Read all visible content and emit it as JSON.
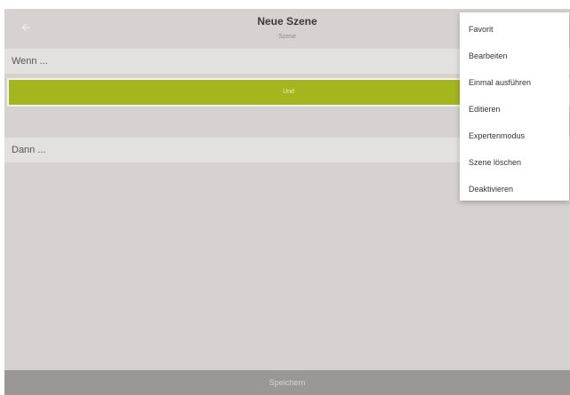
{
  "header": {
    "title": "Neue Szene",
    "subtitle": "Szene",
    "back_icon": "arrow-left-icon"
  },
  "sections": {
    "wenn_label": "Wenn ...",
    "und_label": "Und",
    "dann_label": "Dann ..."
  },
  "footer": {
    "save_label": "Speichern"
  },
  "menu": {
    "items": [
      {
        "label": "Favorit"
      },
      {
        "label": "Bearbeiten"
      },
      {
        "label": "Einmal ausführen"
      },
      {
        "label": "Editieren"
      },
      {
        "label": "Expertenmodus"
      },
      {
        "label": "Szene löschen"
      },
      {
        "label": "Deaktivieren"
      }
    ]
  },
  "colors": {
    "background": "#d6d2d1",
    "accent": "#a4b51d",
    "footer": "#9a9797",
    "section": "#e3e1e0"
  }
}
